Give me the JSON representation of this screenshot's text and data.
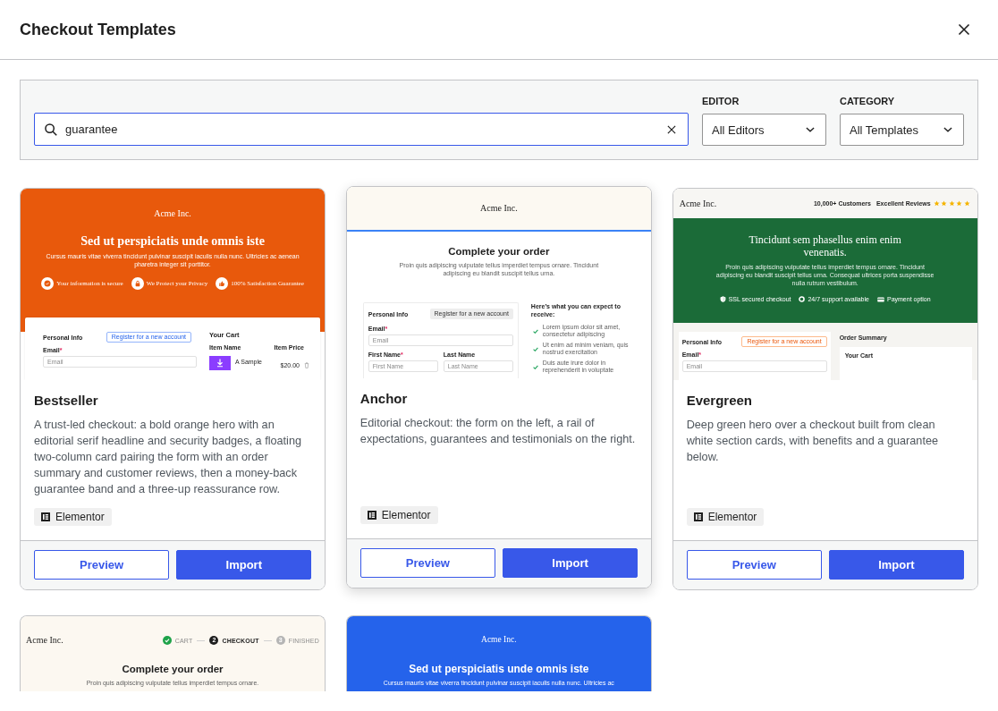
{
  "dialog": {
    "title": "Checkout Templates"
  },
  "filters": {
    "search": {
      "value": "guarantee",
      "focused": true
    },
    "editor": {
      "label": "EDITOR",
      "value": "All Editors"
    },
    "category": {
      "label": "CATEGORY",
      "value": "All Templates"
    }
  },
  "templates": [
    {
      "name": "Bestseller",
      "description": "A trust-led checkout: a bold orange hero with an editorial serif headline and security badges, a floating two-column card pairing the form with an order summary and customer reviews, then a money-back guarantee band and a three-up reassurance row.",
      "builder": "Elementor",
      "hovered": false,
      "actions": [
        {
          "label": "Preview",
          "kind": "secondary"
        },
        {
          "label": "Import",
          "kind": "primary"
        }
      ],
      "preview": {
        "kind": "orange-hero",
        "brand": "Acme Inc.",
        "headline": "Sed ut perspiciatis unde omnis iste",
        "intro": "Cursus mauris vitae viverra tincidunt pulvinar suscipit iaculis nulla nunc. Ultricies ac aenean pharetra integer sit porttitor.",
        "badges": [
          "Your information is secure",
          "We Protect your Privacy",
          "100% Satisfaction Guarantee"
        ],
        "form": {
          "title": "Personal Info",
          "button": "Register for a new account",
          "fields": [
            {
              "label": "Email",
              "mark": "*",
              "placeholder": "Email"
            }
          ]
        },
        "cart": {
          "title": "Your Cart",
          "columns": [
            "Item Name",
            "Item Price"
          ],
          "items": [
            {
              "name": "A Sample",
              "price": "$20.00"
            }
          ]
        }
      }
    },
    {
      "name": "Anchor",
      "description": "Editorial checkout: the form on the left, a rail of expectations, guarantees and testimonials on the right.",
      "builder": "Elementor",
      "hovered": true,
      "actions": [
        {
          "label": "Preview",
          "kind": "secondary"
        },
        {
          "label": "Import",
          "kind": "primary"
        }
      ],
      "preview": {
        "kind": "split-form",
        "brand": "Acme Inc.",
        "headline": "Complete your order",
        "intro": "Proin quis adipiscing vulputate tellus imperdiet tempus ornare. Tincidunt adipiscing eu blandit suscipit tellus urna.",
        "form": {
          "title": "Personal Info",
          "button": "Register for a new account",
          "fields": [
            {
              "label": "Email",
              "mark": "*",
              "placeholder": "Email"
            },
            {
              "label": "First Name",
              "mark": "*",
              "placeholder": "First Name"
            },
            {
              "label": "Last Name",
              "placeholder": "Last Name"
            }
          ]
        },
        "benefits": {
          "title": "Here’s what you can expect to receive:",
          "items": [
            "Lorem ipsum dolor sit amet, consectetur adipiscing",
            "Ut enim ad minim veniam, quis nostrud exercitation",
            "Duis aute irure dolor in reprehenderit in voluptate"
          ]
        }
      }
    },
    {
      "name": "Evergreen",
      "description": "Deep green hero over a checkout built from clean white section cards, with benefits and a guarantee below.",
      "builder": "Elementor",
      "hovered": false,
      "actions": [
        {
          "label": "Preview",
          "kind": "secondary"
        },
        {
          "label": "Import",
          "kind": "primary"
        }
      ],
      "preview": {
        "kind": "green-hero",
        "brand": "Acme Inc.",
        "social_proof": "10,000+ Customers",
        "reviews": {
          "label": "Excellent Reviews",
          "stars": 5
        },
        "headline": "Tincidunt sem phasellus enim enim venenatis.",
        "intro": "Proin quis adipiscing vulputate tellus imperdiet tempus ornare. Tincidunt adipiscing eu blandit suscipit tellus urna. Consequat ultrices porta suspendisse nulla rutrum vestibulum.",
        "features": [
          "SSL secured checkout",
          "24/7 support available",
          "Payment option"
        ],
        "form": {
          "title": "Personal Info",
          "button": "Register for a new account",
          "fields": [
            {
              "label": "Email",
              "mark": "*",
              "placeholder": "Email"
            }
          ]
        },
        "summary": {
          "title": "Order Summary",
          "cart_title": "Your Cart"
        }
      }
    },
    {
      "preview": {
        "kind": "stepper",
        "brand": "Acme Inc.",
        "steps": [
          {
            "label": "CART",
            "done": true,
            "selected": false
          },
          {
            "number": "2",
            "label": "CHECKOUT",
            "done": false,
            "selected": true
          },
          {
            "number": "3",
            "label": "FINISHED",
            "done": false,
            "selected": false
          }
        ],
        "headline": "Complete your order",
        "intro": "Proin quis adipiscing vulputate tellus imperdiet tempus ornare."
      }
    },
    {
      "preview": {
        "kind": "blue-hero",
        "brand": "Acme Inc.",
        "headline": "Sed ut perspiciatis unde omnis iste",
        "intro": "Cursus mauris vitae viverra tincidunt pulvinar suscipit iaculis nulla nunc. Ultricies ac"
      }
    }
  ]
}
